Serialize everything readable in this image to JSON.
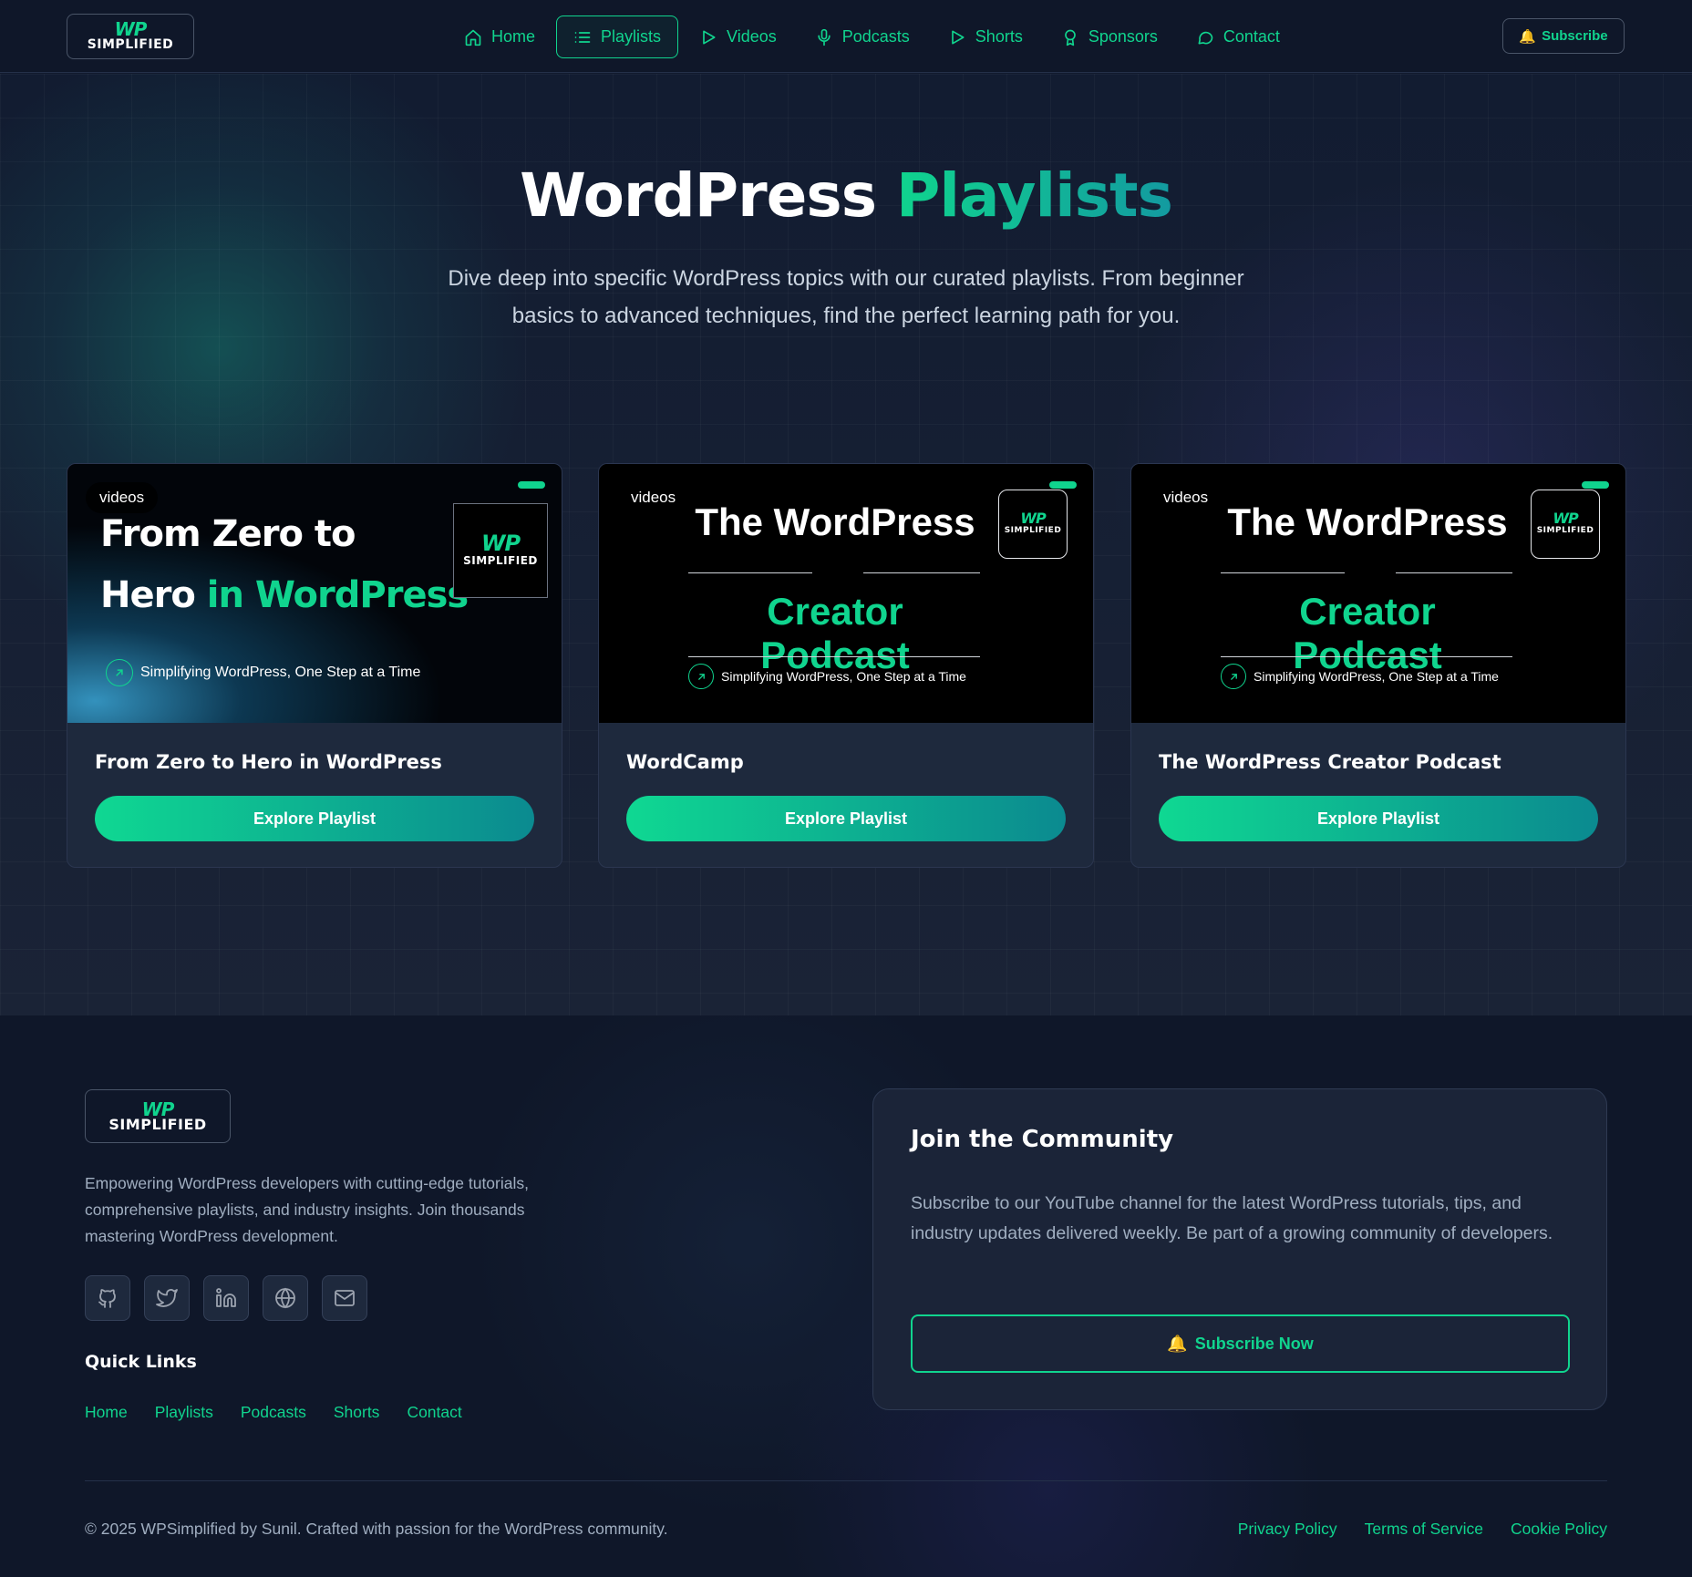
{
  "brand": {
    "logo_mark": "WP",
    "logo_text": "SIMPLIFIED"
  },
  "nav": {
    "items": [
      {
        "label": "Home",
        "icon": "home-icon",
        "active": false
      },
      {
        "label": "Playlists",
        "icon": "list-icon",
        "active": true
      },
      {
        "label": "Videos",
        "icon": "play-icon",
        "active": false
      },
      {
        "label": "Podcasts",
        "icon": "mic-icon",
        "active": false
      },
      {
        "label": "Shorts",
        "icon": "play-icon",
        "active": false
      },
      {
        "label": "Sponsors",
        "icon": "award-icon",
        "active": false
      },
      {
        "label": "Contact",
        "icon": "chat-icon",
        "active": false
      }
    ],
    "subscribe_label": "Subscribe"
  },
  "hero": {
    "title_main": "WordPress",
    "title_accent": "Playlists",
    "subtitle": "Dive deep into specific WordPress topics with our curated playlists. From beginner basics to advanced techniques, find the perfect learning path for you."
  },
  "cards": [
    {
      "badge": "videos",
      "thumb_line1": "From Zero to",
      "thumb_line2_white": "Hero",
      "thumb_line2_green": "in WordPress",
      "tagline": "Simplifying WordPress, One Step at a Time",
      "title": "From Zero to Hero in WordPress",
      "button": "Explore Playlist"
    },
    {
      "badge": "videos",
      "thumb_title": "The WordPress",
      "thumb_sub": "Creator Podcast",
      "tagline": "Simplifying WordPress, One Step at a Time",
      "title": "WordCamp",
      "button": "Explore Playlist"
    },
    {
      "badge": "videos",
      "thumb_title": "The WordPress",
      "thumb_sub": "Creator Podcast",
      "tagline": "Simplifying WordPress, One Step at a Time",
      "title": "The WordPress Creator Podcast",
      "button": "Explore Playlist"
    }
  ],
  "footer": {
    "description": "Empowering WordPress developers with cutting-edge tutorials, comprehensive playlists, and industry insights. Join thousands mastering WordPress development.",
    "socials": [
      "github-icon",
      "twitter-icon",
      "linkedin-icon",
      "globe-icon",
      "mail-icon"
    ],
    "quick_links_title": "Quick Links",
    "quick_links": [
      "Home",
      "Playlists",
      "Podcasts",
      "Shorts",
      "Contact"
    ],
    "community": {
      "title": "Join the Community",
      "description": "Subscribe to our YouTube channel for the latest WordPress tutorials, tips, and industry updates delivered weekly. Be part of a growing community of developers.",
      "button": "Subscribe Now"
    },
    "copyright": "© 2025 WPSimplified by Sunil. Crafted with passion for the WordPress community.",
    "legal": [
      "Privacy Policy",
      "Terms of Service",
      "Cookie Policy"
    ]
  },
  "colors": {
    "accent": "#10d48e",
    "background": "#111a2e",
    "card": "#1e293d"
  }
}
